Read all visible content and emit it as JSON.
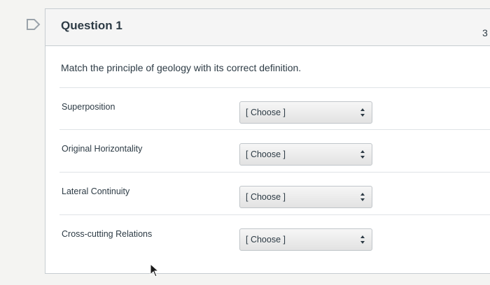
{
  "question": {
    "title": "Question 1",
    "points": "3",
    "prompt": "Match the principle of geology with its correct definition."
  },
  "rows": [
    {
      "label": "Superposition",
      "selected": "[ Choose ]"
    },
    {
      "label": "Original Horizontality",
      "selected": "[ Choose ]"
    },
    {
      "label": "Lateral Continuity",
      "selected": "[ Choose ]"
    },
    {
      "label": "Cross-cutting Relations",
      "selected": "[ Choose ]"
    }
  ],
  "icons": {
    "flag": "flag-outline-icon",
    "select_arrows": "up-down-arrows-icon",
    "cursor": "mouse-pointer-icon"
  },
  "colors": {
    "text": "#2d3b45",
    "header_bg": "#f5f5f5",
    "border": "#c7cdd1"
  }
}
